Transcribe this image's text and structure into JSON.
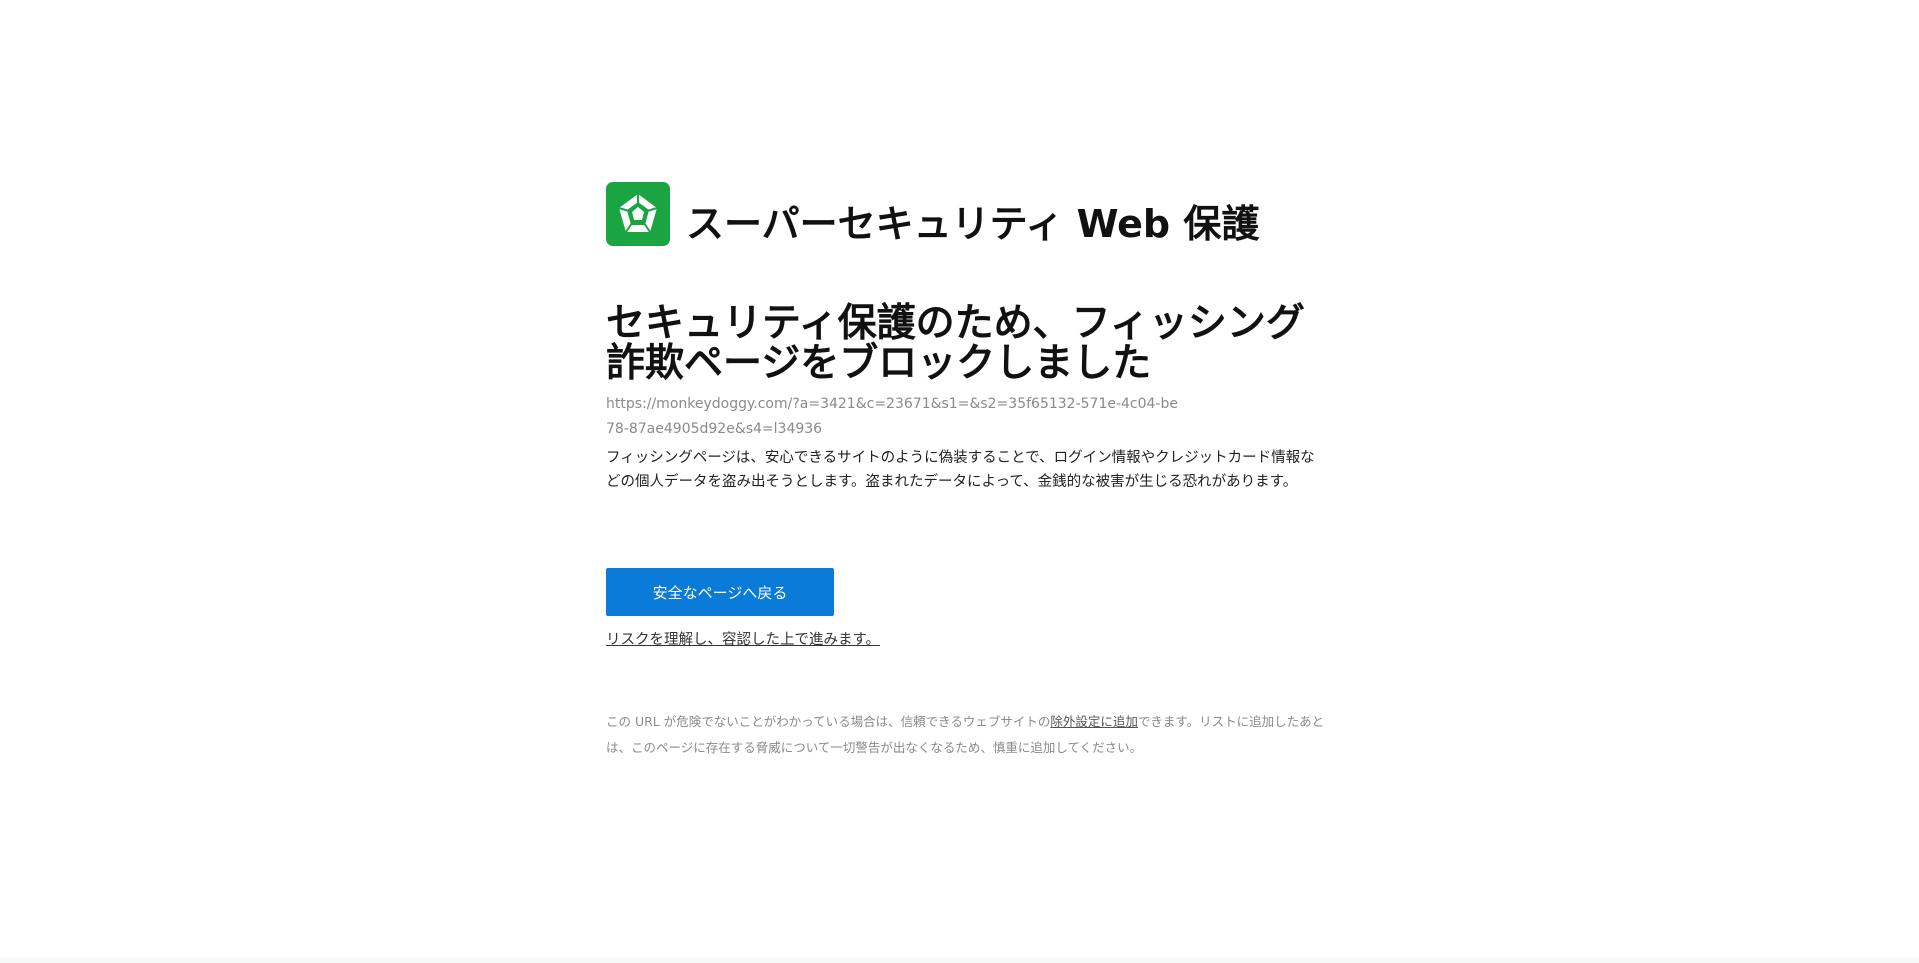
{
  "brand": {
    "logo_icon": "pentagon-shield-icon",
    "name": "スーパーセキュリティ Web 保護",
    "color": "#1aa442"
  },
  "warning": {
    "headline": "セキュリティ保護のため、フィッシング詐欺ページをブロックしました",
    "blocked_url": "https://monkeydoggy.com/?a=3421&c=23671&s1=&s2=35f65132-571e-4c04-be78-87ae4905d92e&s4=l34936",
    "description": "フィッシングページは、安心できるサイトのように偽装することで、ログイン情報やクレジットカード情報などの個人データを盗み出そうとします。盗まれたデータによって、金銭的な被害が生じる恐れがあります。"
  },
  "actions": {
    "back_button_label": "安全なページへ戻る",
    "back_button_color": "#0a7bd8",
    "proceed_link_label": "リスクを理解し、容認した上で進みます。"
  },
  "footnote": {
    "text_before": "この URL が危険でないことがわかっている場合は、信頼できるウェブサイトの",
    "exclusion_link": "除外設定に追加",
    "text_after": "できます。リストに追加したあとは、このページに存在する脅威について一切警告が出なくなるため、慎重に追加してください。"
  }
}
